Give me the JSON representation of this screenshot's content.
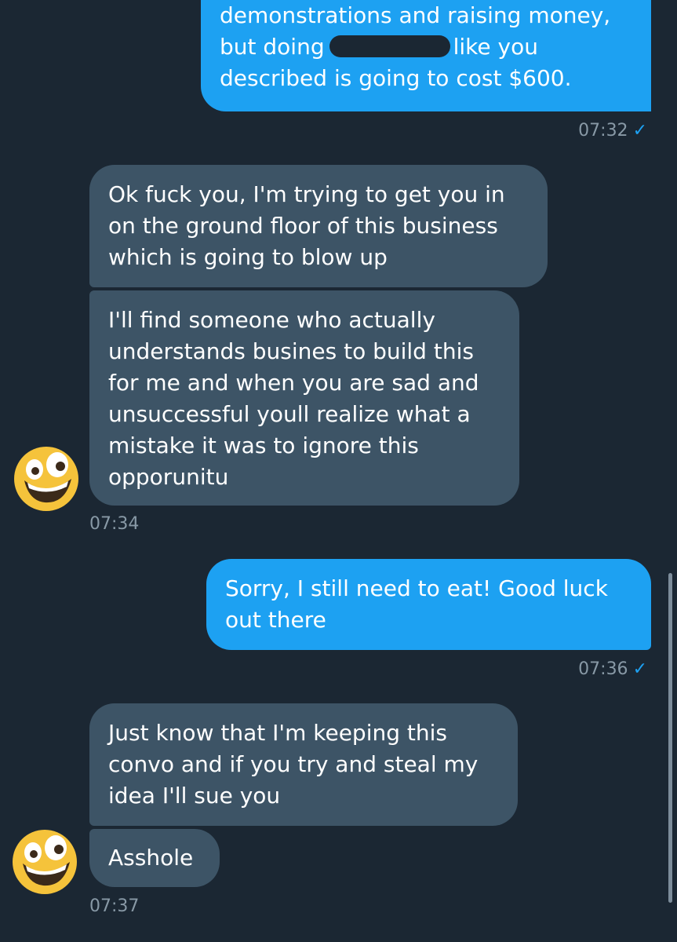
{
  "conversation": {
    "messages": [
      {
        "direction": "outgoing",
        "lines": [
          "demonstrations and raising money,",
          "like you",
          "described is going to cost $600."
        ],
        "line2_prefix": "but doing",
        "time": "07:32",
        "status_icon": "checkmark-icon"
      },
      {
        "direction": "incoming",
        "lines": [
          "Ok fuck you, I'm trying to get you in",
          "on the ground floor of this business",
          "which is going to blow up"
        ]
      },
      {
        "direction": "incoming",
        "lines": [
          "I'll find someone who actually",
          "understands busines to build this",
          "for me and when you are sad and",
          "unsuccessful youll realize what a",
          "mistake it was to ignore this",
          "opporunitu"
        ],
        "time": "07:34",
        "avatar": "grinning-face-icon"
      },
      {
        "direction": "outgoing",
        "lines": [
          "Sorry, I still need to eat! Good luck",
          "out there"
        ],
        "time": "07:36",
        "status_icon": "checkmark-icon"
      },
      {
        "direction": "incoming",
        "lines": [
          "Just know that I'm keeping this",
          "convo and if you try and steal my",
          "idea I'll sue you"
        ]
      },
      {
        "direction": "incoming",
        "lines": [
          "Asshole"
        ],
        "time": "07:37",
        "avatar": "grinning-face-icon"
      }
    ],
    "check_glyph": "✓",
    "colors": {
      "background": "#1b2733",
      "outgoing_bubble": "#1da1f2",
      "incoming_bubble": "#3d5466",
      "timestamp": "#8899a6"
    }
  }
}
